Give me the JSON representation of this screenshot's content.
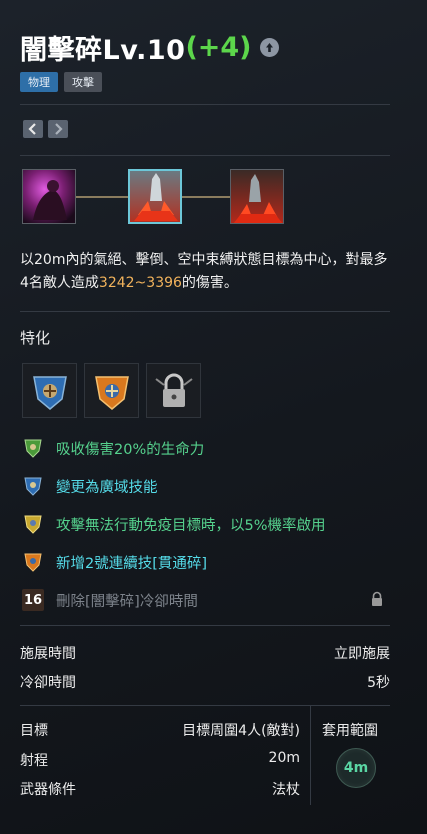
{
  "skill": {
    "name": "闇擊碎Lv.10",
    "bonus": "(+4)",
    "tags": [
      "物理",
      "攻擊"
    ]
  },
  "description": {
    "part1": "以20m內的氣絕、擊倒、空中束縛狀態目標為中心，對最多4名敵人造成",
    "damage": "3242~3396",
    "part2": "的傷害。"
  },
  "specialization": {
    "label": "特化",
    "effects": [
      {
        "text": "吸收傷害20%的生命力",
        "color": "#55d18d"
      },
      {
        "text": "變更為廣域技能",
        "color": "#55dbe8"
      },
      {
        "text": "攻擊無法行動免疫目標時，以5%機率啟用",
        "color": "#55d18d"
      },
      {
        "text": "新增2號連續技[貫通碎]",
        "color": "#55dbe8"
      },
      {
        "text": "刪除[闇擊碎]冷卻時間",
        "level": "16",
        "locked": true
      }
    ]
  },
  "stats": {
    "cast_label": "施展時間",
    "cast_value": "立即施展",
    "cooldown_label": "冷卻時間",
    "cooldown_value": "5秒",
    "target_label": "目標",
    "target_value": "目標周圍4人(敵對)",
    "range_label": "射程",
    "range_value": "20m",
    "weapon_label": "武器條件",
    "weapon_value": "法杖",
    "area_label": "套用範圍",
    "area_value": "4m"
  }
}
